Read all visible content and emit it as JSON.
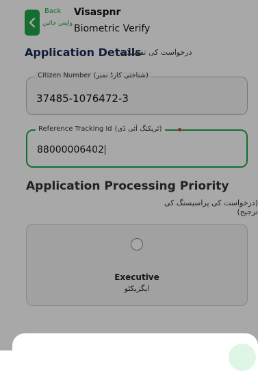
{
  "header": {
    "back_label": "Back",
    "back_label_ur": "واپس جائیں",
    "app_name": "Visaspnr",
    "page_subtitle": "Biometric Verify"
  },
  "section": {
    "title": "Application Details",
    "title_ur": "درخواست کی تفصیلات"
  },
  "fields": {
    "citizen_number": {
      "label": "Citizen Number",
      "label_ur": "(شناختی کارڈ نمبر)",
      "value": "37485-1076472-3"
    },
    "tracking_id": {
      "label": "Reference Tracking Id",
      "label_ur": "(ٹریکنگ آئی ڈی)",
      "value": "88000006402"
    }
  },
  "priority": {
    "title": "Application Processing Priority",
    "title_ur": "(درخواست کی پراسیسنگ کی ترجیح)",
    "option": {
      "label": "Executive",
      "label_ur": "ایگزیکٹو",
      "selected": false
    }
  },
  "colors": {
    "accent": "#1fa84a",
    "heading": "#1a2a55",
    "required": "#e03a3a"
  }
}
